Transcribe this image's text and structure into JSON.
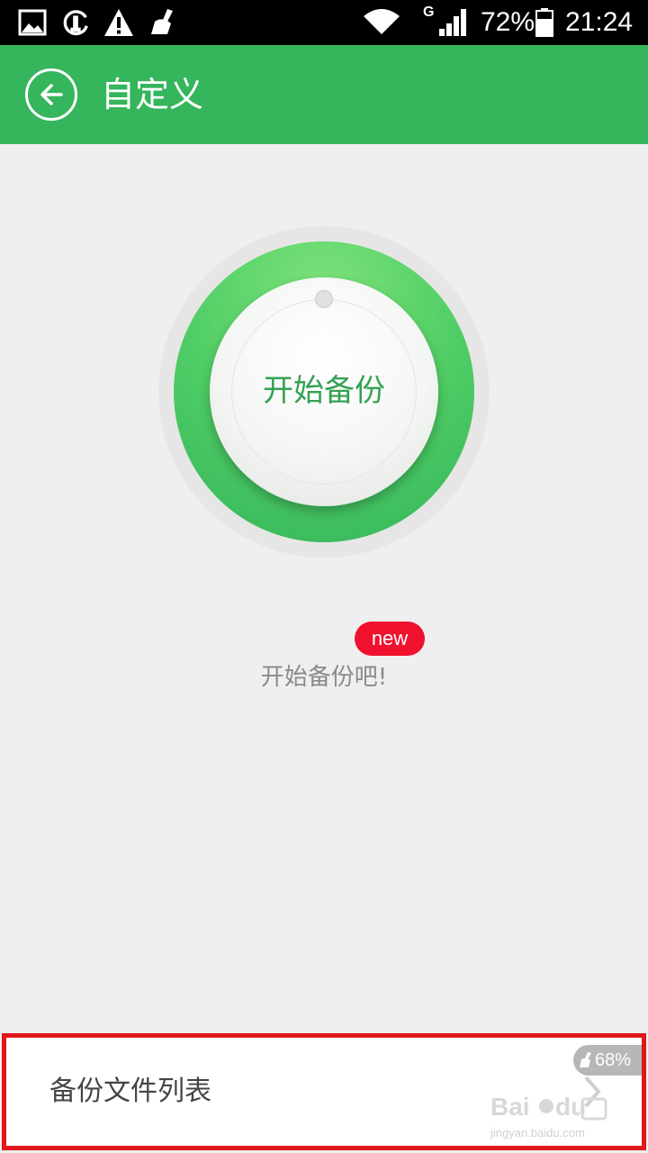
{
  "status_bar": {
    "icons": [
      "image-notification-icon",
      "sync-notification-icon",
      "warning-icon",
      "cleaner-icon",
      "wifi-icon",
      "cellular-signal-icon",
      "battery-icon"
    ],
    "network_type": "G",
    "battery": "72%",
    "time": "21:24"
  },
  "app_bar": {
    "back_icon": "back-arrow-icon",
    "title": "自定义"
  },
  "dial": {
    "button_label": "开始备份"
  },
  "hint": {
    "badge": "new",
    "text": "开始备份吧!"
  },
  "bottom": {
    "list_label": "备份文件列表",
    "memory_percent": "68%"
  },
  "colors": {
    "accent": "#35b55c",
    "badge_red": "#f0112e",
    "highlight_border": "#e01818"
  }
}
